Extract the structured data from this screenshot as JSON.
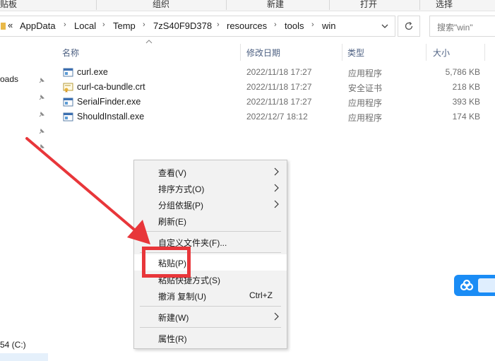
{
  "ribbon": {
    "items": [
      "贴板",
      "组织",
      "新建",
      "打开",
      "选择"
    ]
  },
  "address": {
    "overflow": "«",
    "crumbs": [
      "AppData",
      "Local",
      "Temp",
      "7zS40F9D378",
      "resources",
      "tools",
      "win"
    ]
  },
  "search": {
    "placeholder": "搜索\"win\""
  },
  "nav": {
    "downloads_fragment": "oads",
    "drive_fragment": "54 (C:)"
  },
  "columns": {
    "name": "名称",
    "date": "修改日期",
    "type": "类型",
    "size": "大小"
  },
  "files": [
    {
      "name": "curl.exe",
      "date": "2022/11/18 17:27",
      "type": "应用程序",
      "size": "5,786 KB",
      "icon": "exe-icon"
    },
    {
      "name": "curl-ca-bundle.crt",
      "date": "2022/11/18 17:27",
      "type": "安全证书",
      "size": "218 KB",
      "icon": "certificate-icon"
    },
    {
      "name": "SerialFinder.exe",
      "date": "2022/11/18 17:27",
      "type": "应用程序",
      "size": "393 KB",
      "icon": "exe-icon"
    },
    {
      "name": "ShouldInstall.exe",
      "date": "2022/12/7 18:12",
      "type": "应用程序",
      "size": "174 KB",
      "icon": "exe-icon"
    }
  ],
  "context_menu": {
    "view": "查看(V)",
    "sort": "排序方式(O)",
    "group": "分组依据(P)",
    "refresh": "刷新(E)",
    "customize": "自定义文件夹(F)...",
    "paste": "粘贴(P)",
    "paste_shortcut": "粘贴快捷方式(S)",
    "undo": "撤消 复制(U)",
    "undo_shortcut": "Ctrl+Z",
    "new": "新建(W)",
    "properties": "属性(R)"
  },
  "colors": {
    "annotation_red": "#e8363a",
    "menu_bg": "#f2f2f2",
    "header_text": "#4d6082",
    "cloud_blue": "#1a8cf5"
  }
}
